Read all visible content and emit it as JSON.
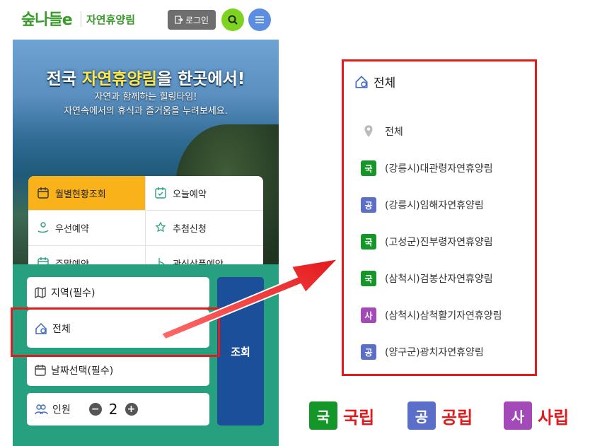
{
  "header": {
    "logo_text": "숲나들e",
    "logo_sub": "자연휴양림",
    "login_label": "로그인"
  },
  "hero": {
    "title_prefix": "전국 ",
    "title_highlight": "자연휴양림",
    "title_suffix": "을 한곳에서!",
    "subtitle_1": "자연과 함께하는 힐링타임!",
    "subtitle_2": "자연속에서의 휴식과 즐거움을 누려보세요."
  },
  "menu_grid": [
    {
      "label": "월별현황조회",
      "icon": "calendar-icon",
      "active": true
    },
    {
      "label": "오늘예약",
      "icon": "calendar-check-icon",
      "active": false
    },
    {
      "label": "우선예약",
      "icon": "hand-person-icon",
      "active": false
    },
    {
      "label": "추첨신청",
      "icon": "star-hand-icon",
      "active": false
    },
    {
      "label": "주말예약",
      "icon": "calendar-icon",
      "active": false
    },
    {
      "label": "관심상품예약",
      "icon": "pointer-hand-icon",
      "active": false
    }
  ],
  "search": {
    "region_label": "지역(필수)",
    "selected_label": "전체",
    "date_label": "날짜선택(필수)",
    "people_label": "인원",
    "people_count": "2",
    "minus": "−",
    "plus": "+",
    "query_label": "조회"
  },
  "dropdown": {
    "header": "전체",
    "items": [
      {
        "badge": "",
        "label": "전체",
        "type": "all"
      },
      {
        "badge": "국",
        "label": "(강릉시)대관령자연휴양림",
        "type": "guk"
      },
      {
        "badge": "공",
        "label": "(강릉시)임해자연휴양림",
        "type": "gong"
      },
      {
        "badge": "국",
        "label": "(고성군)진부령자연휴양림",
        "type": "guk"
      },
      {
        "badge": "국",
        "label": "(삼척시)검봉산자연휴양림",
        "type": "guk"
      },
      {
        "badge": "사",
        "label": "(삼척시)삼척활기자연휴양림",
        "type": "sa"
      },
      {
        "badge": "공",
        "label": "(양구군)광치자연휴양림",
        "type": "gong"
      }
    ]
  },
  "legend": [
    {
      "badge": "국",
      "label": "국립"
    },
    {
      "badge": "공",
      "label": "공립"
    },
    {
      "badge": "사",
      "label": "사립"
    }
  ],
  "colors": {
    "accent_red": "#e3191b",
    "guk_green": "#159629",
    "gong_blue": "#5b6fc9",
    "sa_purple": "#a34ab8",
    "panel_green": "#26a07f",
    "query_blue": "#1b4f9a"
  }
}
